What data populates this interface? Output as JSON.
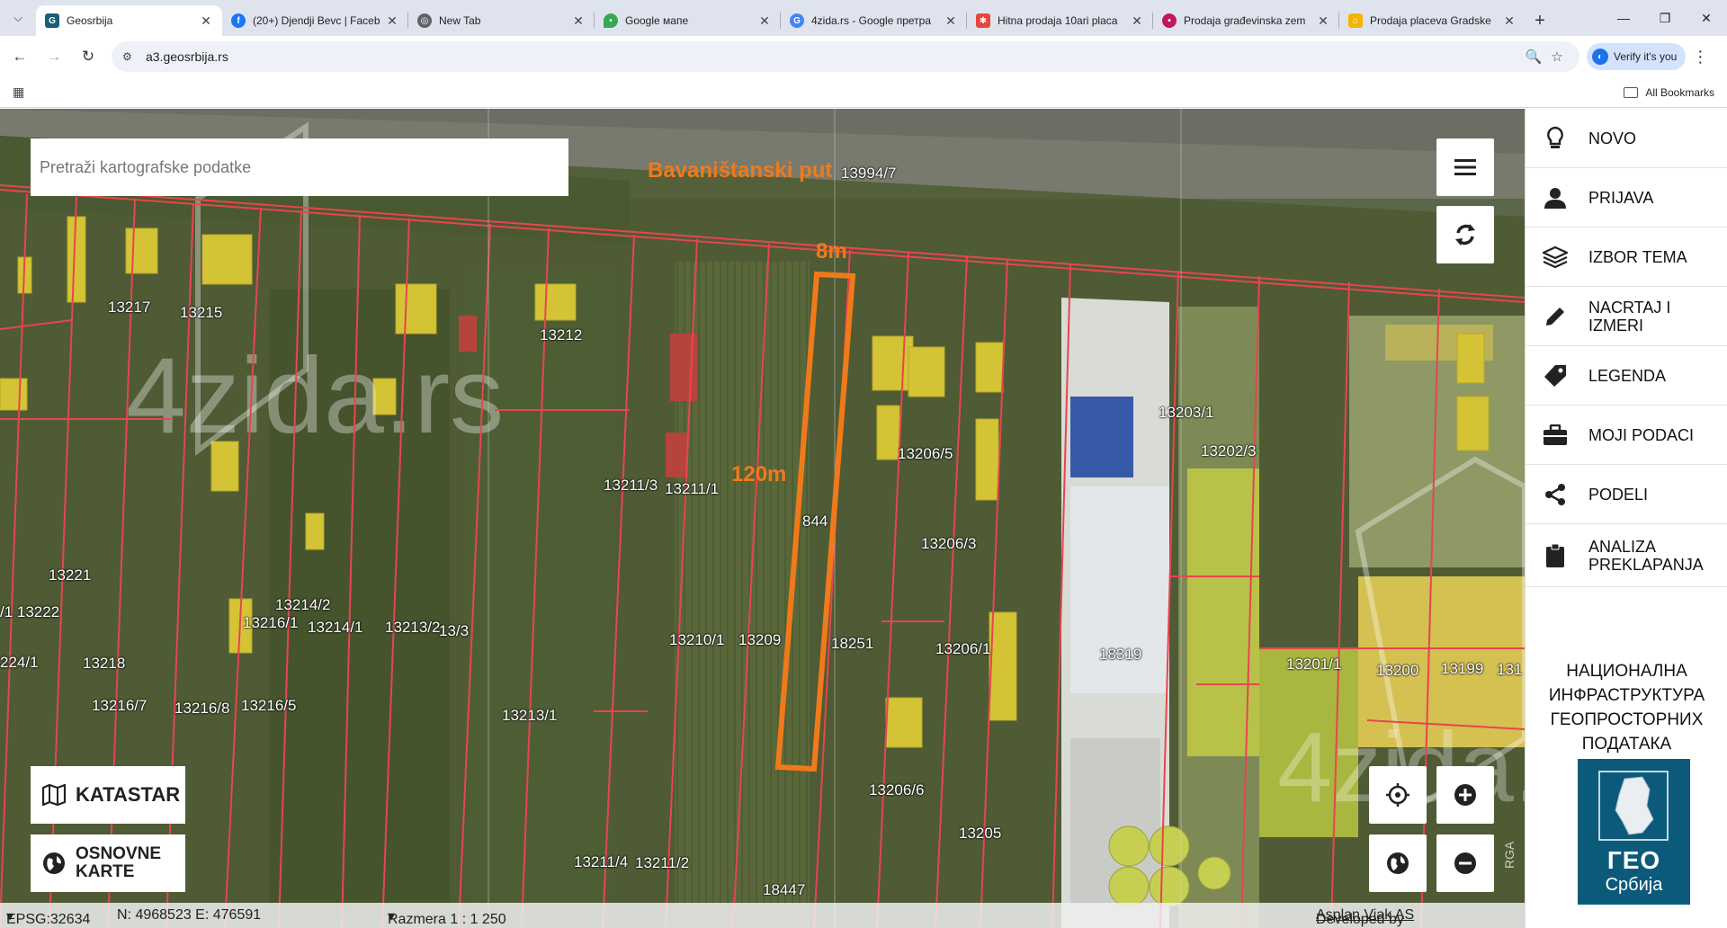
{
  "browser": {
    "tabs": [
      {
        "title": "Geosrbija",
        "active": true,
        "favicon_color": "#1b5e7a",
        "favicon": "geo-icon"
      },
      {
        "title": "(20+) Djendji Bevc | Faceb",
        "active": false,
        "favicon_color": "#1877f2",
        "favicon": "facebook-icon"
      },
      {
        "title": "New Tab",
        "active": false,
        "favicon_color": "#5f6368",
        "favicon": "chrome-icon"
      },
      {
        "title": "Google мапе",
        "active": false,
        "favicon_color": "#34a853",
        "favicon": "maps-pin-icon"
      },
      {
        "title": "4zida.rs - Google претра",
        "active": false,
        "favicon_color": "#4285f4",
        "favicon": "google-icon"
      },
      {
        "title": "Hitna prodaja 10ari placa",
        "active": false,
        "favicon_color": "#e8453c",
        "favicon": "halo-icon"
      },
      {
        "title": "Prodaja građevinska zem",
        "active": false,
        "favicon_color": "#c2185b",
        "favicon": "drop-icon"
      },
      {
        "title": "Prodaja placeva Gradske",
        "active": false,
        "favicon_color": "#f4b400",
        "favicon": "house-icon"
      }
    ],
    "url": "a3.geosrbija.rs",
    "verify_label": "Verify it's you",
    "all_bookmarks": "All Bookmarks"
  },
  "map": {
    "search_placeholder": "Pretraži kartografske podatke",
    "buttons": {
      "katastar": "KATASTAR",
      "osnovne_line1": "OSNOVNE",
      "osnovne_line2": "KARTE"
    },
    "annotations": {
      "street": "Bavaništanski put",
      "width": "8m",
      "length": "120m"
    },
    "parcel_labels": [
      "13994/7",
      "13217",
      "13215",
      "13212",
      "13203/1",
      "13202/3",
      "13206/5",
      "13211/3",
      "13211/1",
      "844",
      "13206/3",
      "13221",
      "/1 13222",
      "13214/2",
      "13216/1",
      "13214/1",
      "13213/2",
      "13/3",
      "224/1",
      "13218",
      "13210/1",
      "13209",
      "18251",
      "13206/1",
      "18319",
      "13201/1",
      "13200",
      "13199",
      "131",
      "13216/7",
      "13216/8",
      "13216/5",
      "13213/1",
      "13206/6",
      "13205",
      "13211/4",
      "13211/2",
      "18447"
    ],
    "status": {
      "epsg": "EPSG:32634",
      "coords": "N: 4968523 E: 476591",
      "scale": "Razmera 1 : 1 250",
      "developed_by": "Developed by",
      "developer": "Asplan Viak AS"
    },
    "watermark": "4zida.rs",
    "attribution_vertical": "RGA"
  },
  "sidebar": {
    "items": [
      {
        "label": "NOVO",
        "icon": "lightbulb-icon"
      },
      {
        "label": "PRIJAVA",
        "icon": "user-icon"
      },
      {
        "label": "IZBOR TEMA",
        "icon": "layers-icon"
      },
      {
        "label": "NACRTAJ I IZMERI",
        "icon": "pencil-icon"
      },
      {
        "label": "LEGENDA",
        "icon": "tag-icon"
      },
      {
        "label": "MOJI PODACI",
        "icon": "briefcase-icon"
      },
      {
        "label": "PODELI",
        "icon": "share-icon"
      },
      {
        "label": "ANALIZA PREKLAPANJA",
        "icon": "clipboard-icon"
      }
    ],
    "nipp_lines": [
      "НАЦИОНАЛНА",
      "ИНФРАСТРУКТУРА",
      "ГЕОПРОСТОРНИХ",
      "ПОДАТАКА"
    ],
    "logo_title": "ГЕО",
    "logo_subtitle": "Србија"
  },
  "colors": {
    "annotation": "#f07a1a",
    "parcel_line": "#e8454f",
    "logo_bg": "#0c5a7a"
  }
}
